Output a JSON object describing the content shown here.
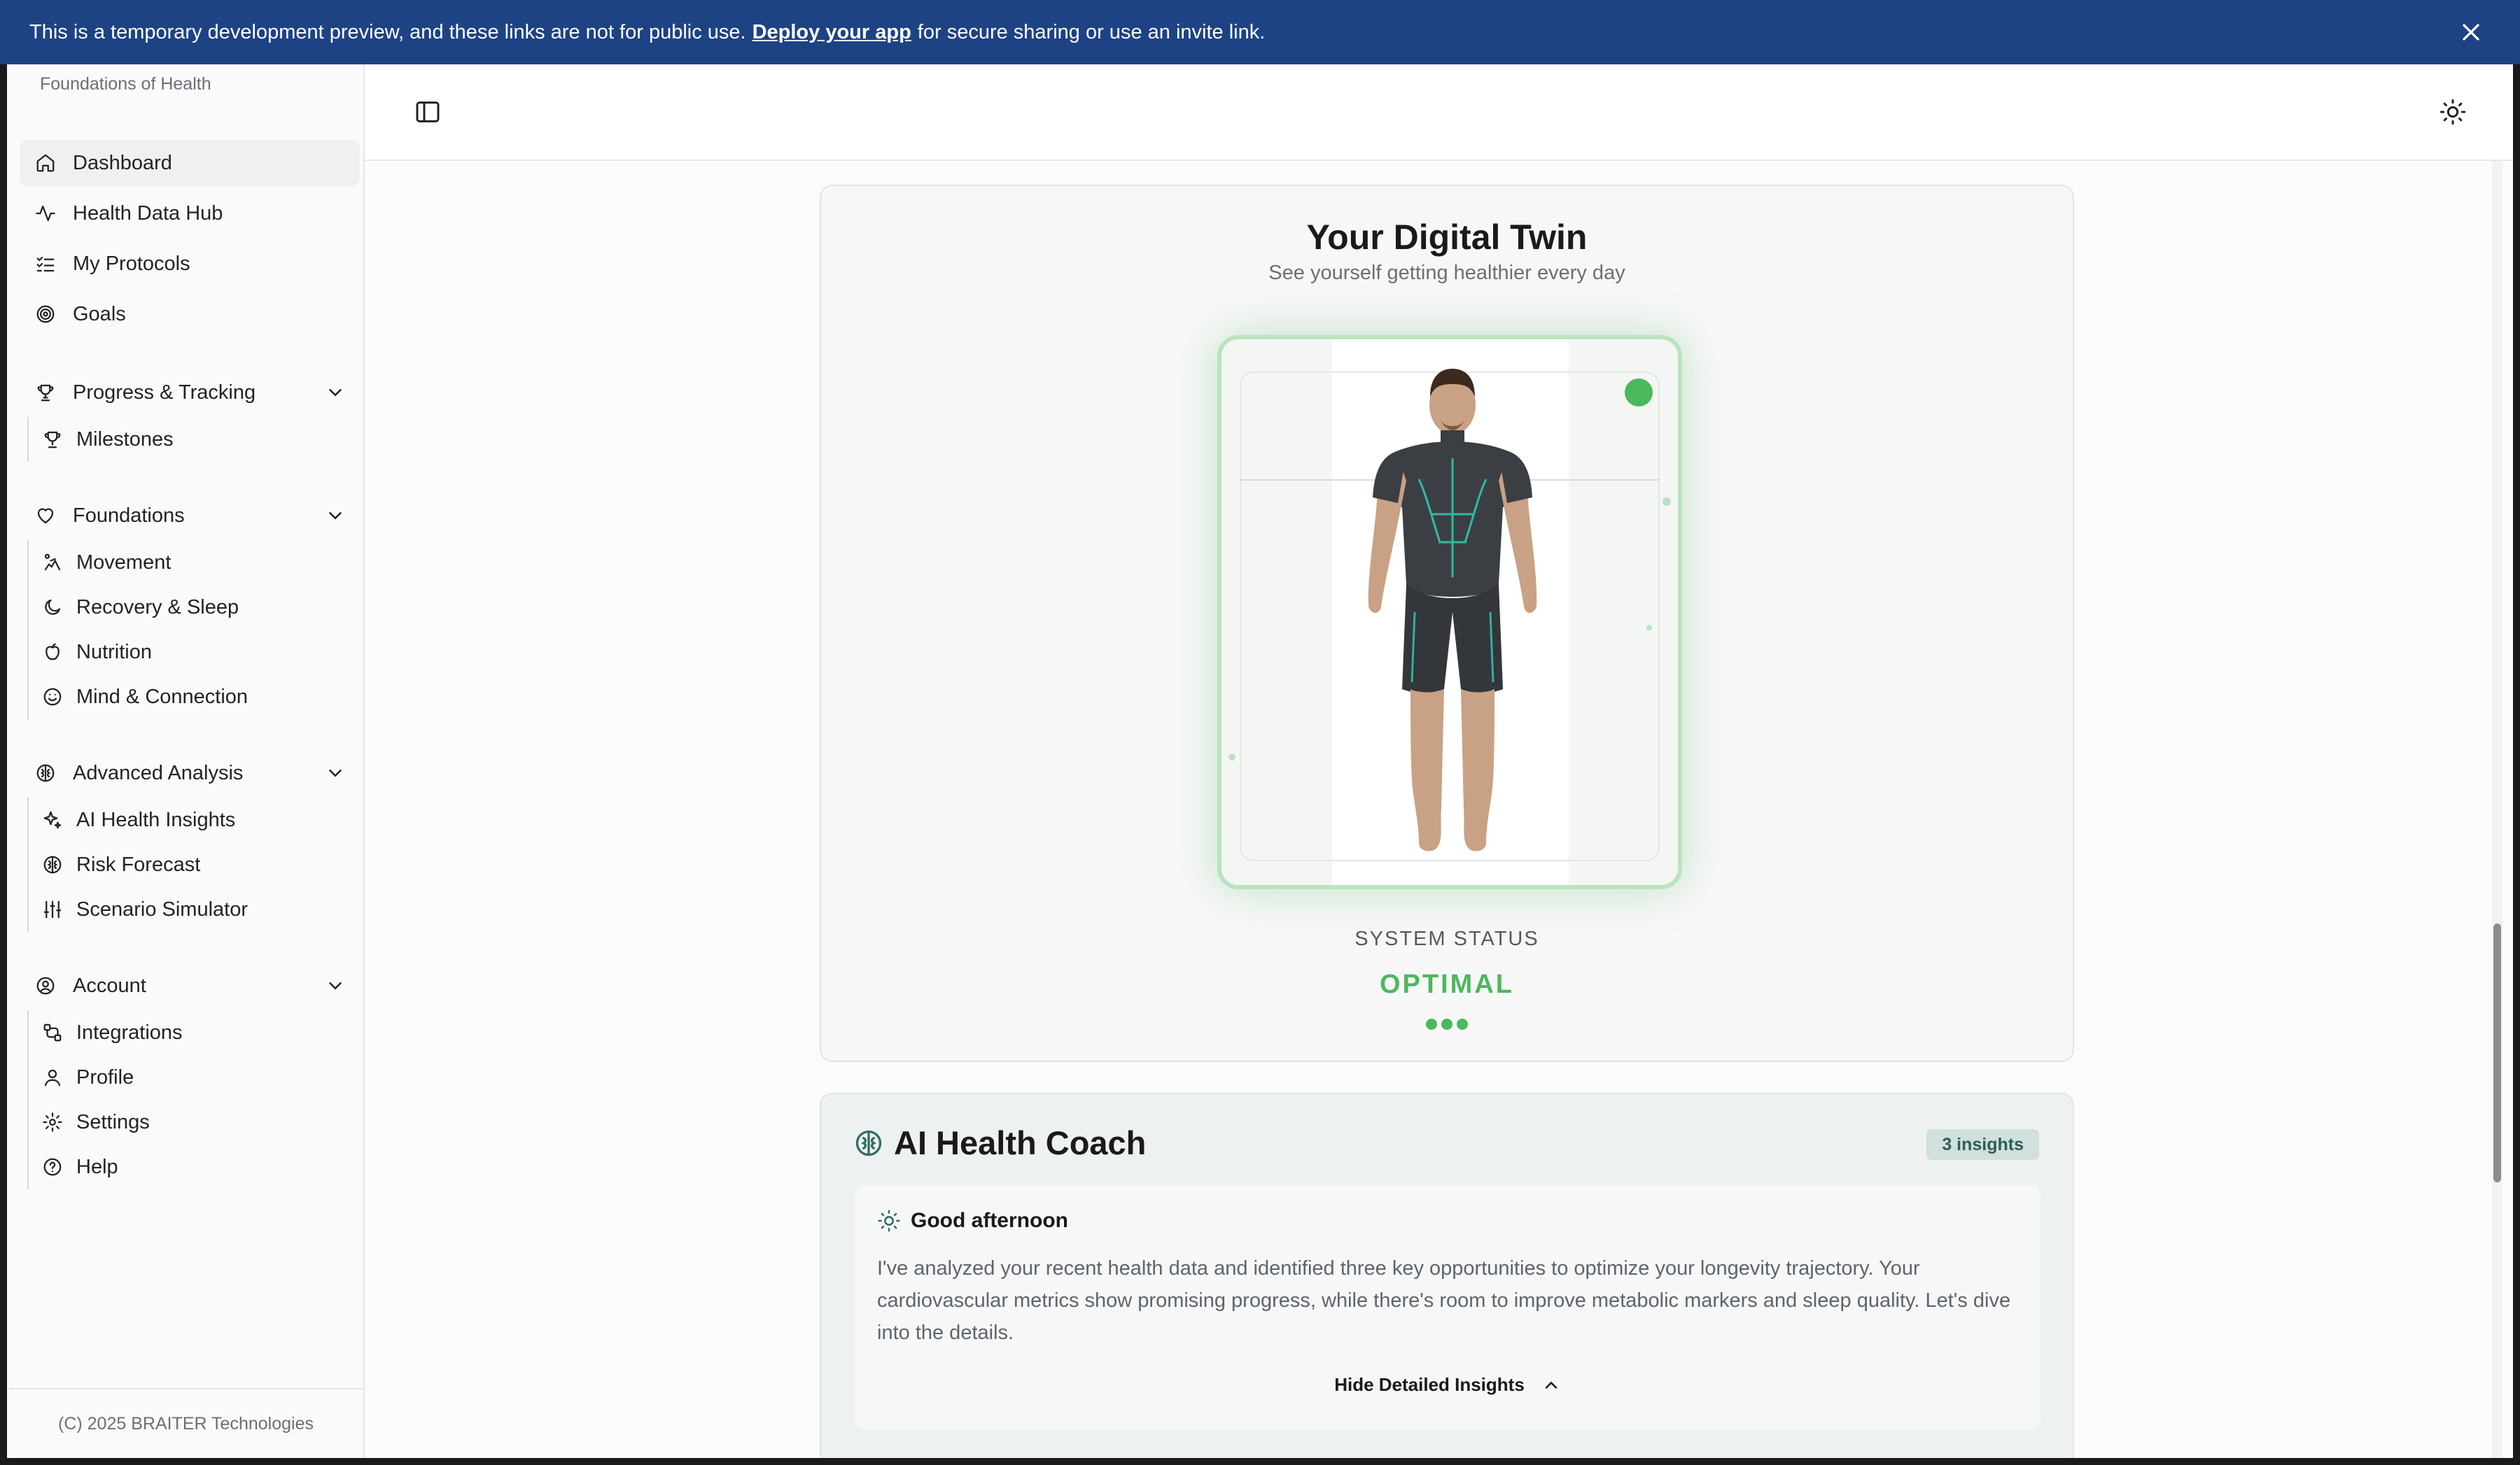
{
  "banner": {
    "text_before": "This is a temporary development preview, and these links are not for public use.",
    "link": "Deploy your app",
    "text_after": "for secure sharing or use an invite link."
  },
  "sidebar": {
    "subtitle": "Foundations of Health",
    "items": [
      {
        "label": "Dashboard",
        "icon": "home-icon",
        "active": true
      },
      {
        "label": "Health Data Hub",
        "icon": "activity-icon"
      },
      {
        "label": "My Protocols",
        "icon": "list-checks-icon"
      },
      {
        "label": "Goals",
        "icon": "target-icon"
      }
    ],
    "groups": [
      {
        "label": "Progress & Tracking",
        "icon": "trophy-icon",
        "items": [
          {
            "label": "Milestones",
            "icon": "trophy-icon"
          }
        ]
      },
      {
        "label": "Foundations",
        "icon": "heart-icon",
        "items": [
          {
            "label": "Movement",
            "icon": "movement-icon"
          },
          {
            "label": "Recovery & Sleep",
            "icon": "moon-icon"
          },
          {
            "label": "Nutrition",
            "icon": "apple-icon"
          },
          {
            "label": "Mind & Connection",
            "icon": "smile-icon"
          }
        ]
      },
      {
        "label": "Advanced Analysis",
        "icon": "brain-icon",
        "items": [
          {
            "label": "AI Health Insights",
            "icon": "sparkles-icon"
          },
          {
            "label": "Risk Forecast",
            "icon": "brain-icon"
          },
          {
            "label": "Scenario Simulator",
            "icon": "sliders-icon"
          }
        ]
      },
      {
        "label": "Account",
        "icon": "user-circle-icon",
        "items": [
          {
            "label": "Integrations",
            "icon": "workflow-icon"
          },
          {
            "label": "Profile",
            "icon": "user-icon"
          },
          {
            "label": "Settings",
            "icon": "gear-icon"
          },
          {
            "label": "Help",
            "icon": "help-circle-icon"
          }
        ]
      }
    ],
    "footer": "(C) 2025 BRAITER Technologies"
  },
  "twin": {
    "title": "Your Digital Twin",
    "subtitle": "See yourself getting healthier every day",
    "status_label": "SYSTEM STATUS",
    "status_value": "OPTIMAL",
    "status_color": "#4cb85c"
  },
  "coach": {
    "title": "AI Health Coach",
    "badge": "3 insights",
    "greeting": "Good afternoon",
    "message": "I've analyzed your recent health data and identified three key opportunities to optimize your longevity trajectory. Your cardiovascular metrics show promising progress, while there's room to improve metabolic markers and sleep quality. Let's dive into the details.",
    "toggle_label": "Hide Detailed Insights"
  },
  "colors": {
    "banner": "#1d4384",
    "accent_green": "#4cb85c",
    "badge_bg": "#cfe0dd"
  }
}
